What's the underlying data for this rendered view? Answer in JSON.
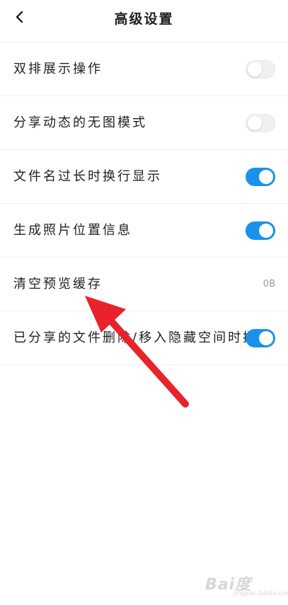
{
  "header": {
    "title": "高级设置",
    "back_icon": "chevron-left-icon"
  },
  "settings": [
    {
      "label": "双排展示操作",
      "control": "toggle",
      "state": "off"
    },
    {
      "label": "分享动态的无图模式",
      "control": "toggle",
      "state": "off"
    },
    {
      "label": "文件名过长时换行显示",
      "control": "toggle",
      "state": "on"
    },
    {
      "label": "生成照片位置信息",
      "control": "toggle",
      "state": "on"
    },
    {
      "label": "清空预览缓存",
      "control": "value",
      "value": "0B"
    },
    {
      "label": "已分享的文件删除/移入隐藏空间时提示",
      "control": "toggle",
      "state": "on"
    }
  ],
  "colors": {
    "toggle_on": "#1a91ea",
    "toggle_off": "#f0f0f0",
    "annotation_arrow": "#e8232b"
  },
  "watermark": {
    "logo": "Bai度",
    "sub": "jingyan.baidu.com"
  }
}
